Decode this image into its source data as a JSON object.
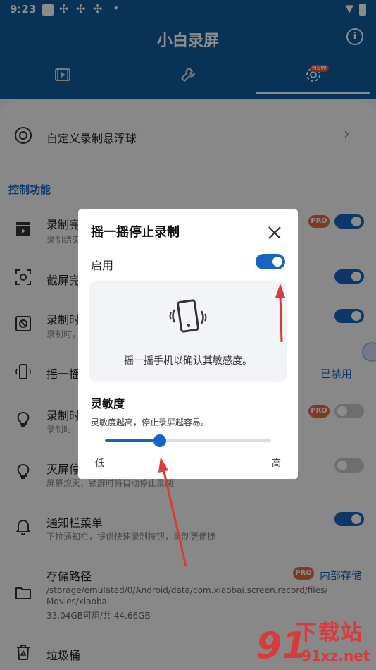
{
  "status_bar": {
    "time": "9:23"
  },
  "app": {
    "title": "小白录屏",
    "tab_badge": "NEW"
  },
  "list": {
    "custom_float": {
      "title": "自定义录制悬浮球"
    },
    "section_title": "控制功能",
    "items": [
      {
        "title": "录制完",
        "subtitle": "录制结束",
        "pro": true,
        "switch_on": true
      },
      {
        "title": "截屏完",
        "subtitle": "",
        "pro": false,
        "switch_on": true
      },
      {
        "title": "录制时",
        "subtitle": "录制时，",
        "pro": false,
        "switch_on": true
      },
      {
        "title": "摇一摇",
        "subtitle": "",
        "pro": false,
        "status_text": "已禁用"
      },
      {
        "title": "录制时",
        "subtitle": "录制时",
        "pro": true,
        "switch_on": false
      },
      {
        "title": "灭屏停",
        "subtitle": "屏幕熄灭、锁屏时将自动停止录制",
        "pro": false,
        "switch_on": false
      },
      {
        "title": "通知栏菜单",
        "subtitle": "下拉通知栏，提供快速录制按钮，录制更便捷",
        "pro": false,
        "switch_on": true
      }
    ],
    "storage": {
      "title": "存储路径",
      "value": "内部存储",
      "path_line1": "/storage/emulated/0/Android/data/com.xiaobai.screen.record/files/",
      "path_line2": "Movies/xiaobai",
      "usage": "33.04GB可用/共 44.66GB"
    },
    "trash": {
      "title": "垃圾桶"
    },
    "pro_label": "PRO"
  },
  "dialog": {
    "title": "摇一摇停止录制",
    "enable_label": "启用",
    "enabled": true,
    "card_text": "摇一摇手机以确认其敏感度。",
    "sensitivity_title": "灵敏度",
    "sensitivity_desc": "灵敏度越高，停止录屏越容易。",
    "sensitivity_value": 0.33,
    "low_label": "低",
    "high_label": "高"
  },
  "watermark": {
    "text": "下载站",
    "url": "91xz.net",
    "logo": "91"
  },
  "colors": {
    "primary": "#115c9e",
    "accent": "#1565c0",
    "pro": "#e36b4a",
    "annotation": "#d93a3a"
  }
}
